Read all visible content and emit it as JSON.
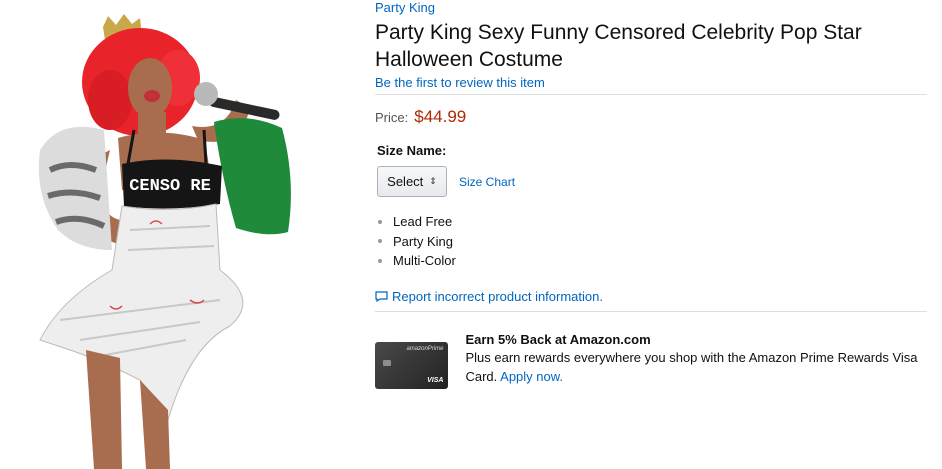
{
  "brand": "Party King",
  "title": "Party King Sexy Funny Censored Celebrity Pop Star Halloween Costume",
  "review_link": "Be the first to review this item",
  "price": {
    "label": "Price:",
    "value": "$44.99"
  },
  "size": {
    "label": "Size Name:",
    "select_value": "Select",
    "chart_link": "Size Chart"
  },
  "features": [
    "Lead Free",
    "Party King",
    "Multi-Color"
  ],
  "report_link": "Report incorrect product information.",
  "promo": {
    "title": "Earn 5% Back at Amazon.com",
    "body": "Plus earn rewards everywhere you shop with the Amazon Prime Rewards Visa Card.",
    "link": "Apply now.",
    "card_brand": "amazonPrime",
    "card_network": "VISA"
  },
  "product_image": {
    "top_text": "CENSO RE"
  },
  "colors": {
    "link": "#0066c0",
    "price": "#b12704",
    "wig": "#e8232a",
    "scarf_green": "#1f8a3a"
  }
}
